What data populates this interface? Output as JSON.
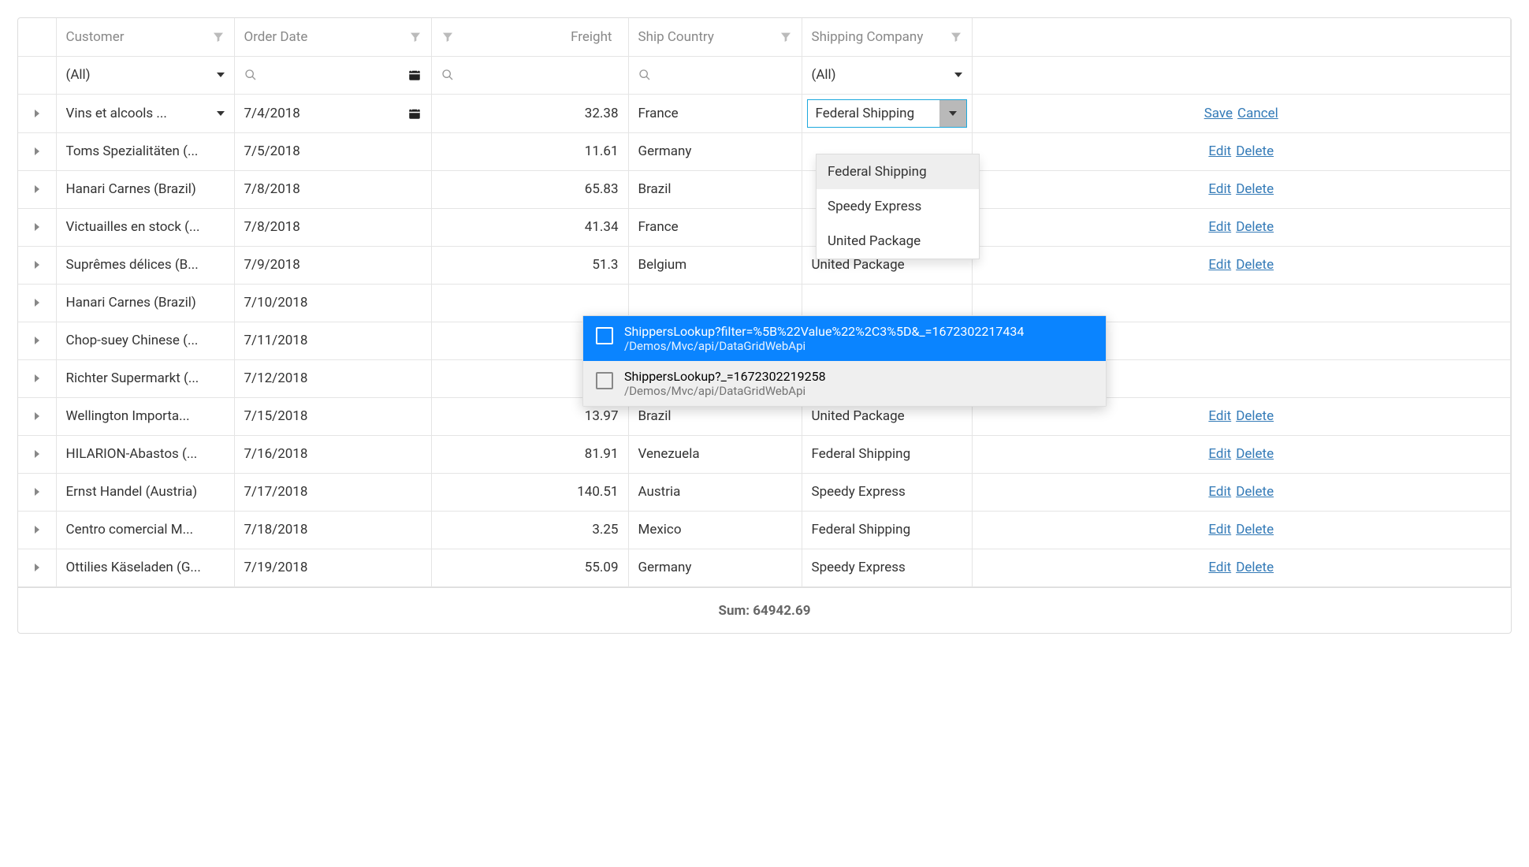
{
  "columns": {
    "customer": "Customer",
    "order_date": "Order Date",
    "freight": "Freight",
    "ship_country": "Ship Country",
    "shipping_company": "Shipping Company"
  },
  "filters": {
    "customer": "(All)",
    "shipper": "(All)"
  },
  "edit_row": {
    "customer": "Vins et alcools ...",
    "date": "7/4/2018",
    "freight": "32.38",
    "country": "France",
    "shipper": "Federal Shipping",
    "save": "Save",
    "cancel": "Cancel"
  },
  "shipper_options": [
    "Federal Shipping",
    "Speedy Express",
    "United Package"
  ],
  "rows": [
    {
      "customer": "Toms Spezialitäten (...",
      "date": "7/5/2018",
      "freight": "11.61",
      "country": "Germany",
      "shipper": ""
    },
    {
      "customer": "Hanari Carnes (Brazil)",
      "date": "7/8/2018",
      "freight": "65.83",
      "country": "Brazil",
      "shipper": ""
    },
    {
      "customer": "Victuailles en stock (...",
      "date": "7/8/2018",
      "freight": "41.34",
      "country": "France",
      "shipper": ""
    },
    {
      "customer": "Suprêmes délices (B...",
      "date": "7/9/2018",
      "freight": "51.3",
      "country": "Belgium",
      "shipper": "United Package"
    },
    {
      "customer": "Hanari Carnes (Brazil)",
      "date": "7/10/2018",
      "freight": "",
      "country": "",
      "shipper": ""
    },
    {
      "customer": "Chop-suey Chinese (...",
      "date": "7/11/2018",
      "freight": "",
      "country": "",
      "shipper": ""
    },
    {
      "customer": "Richter Supermarkt (...",
      "date": "7/12/2018",
      "freight": "",
      "country": "",
      "shipper": ""
    },
    {
      "customer": "Wellington Importa...",
      "date": "7/15/2018",
      "freight": "13.97",
      "country": "Brazil",
      "shipper": "United Package"
    },
    {
      "customer": "HILARION-Abastos (...",
      "date": "7/16/2018",
      "freight": "81.91",
      "country": "Venezuela",
      "shipper": "Federal Shipping"
    },
    {
      "customer": "Ernst Handel (Austria)",
      "date": "7/17/2018",
      "freight": "140.51",
      "country": "Austria",
      "shipper": "Speedy Express"
    },
    {
      "customer": "Centro comercial M...",
      "date": "7/18/2018",
      "freight": "3.25",
      "country": "Mexico",
      "shipper": "Federal Shipping"
    },
    {
      "customer": "Ottilies Käseladen (G...",
      "date": "7/19/2018",
      "freight": "55.09",
      "country": "Germany",
      "shipper": "Speedy Express"
    }
  ],
  "row_actions": {
    "edit": "Edit",
    "delete": "Delete"
  },
  "footer": {
    "sum_label": "Sum: 64942.69"
  },
  "suggestions": [
    {
      "line1": "ShippersLookup?filter=%5B%22Value%22%2C3%5D&_=1672302217434",
      "line2": "/Demos/Mvc/api/DataGridWebApi",
      "active": true
    },
    {
      "line1": "ShippersLookup?_=1672302219258",
      "line2": "/Demos/Mvc/api/DataGridWebApi",
      "active": false
    }
  ]
}
